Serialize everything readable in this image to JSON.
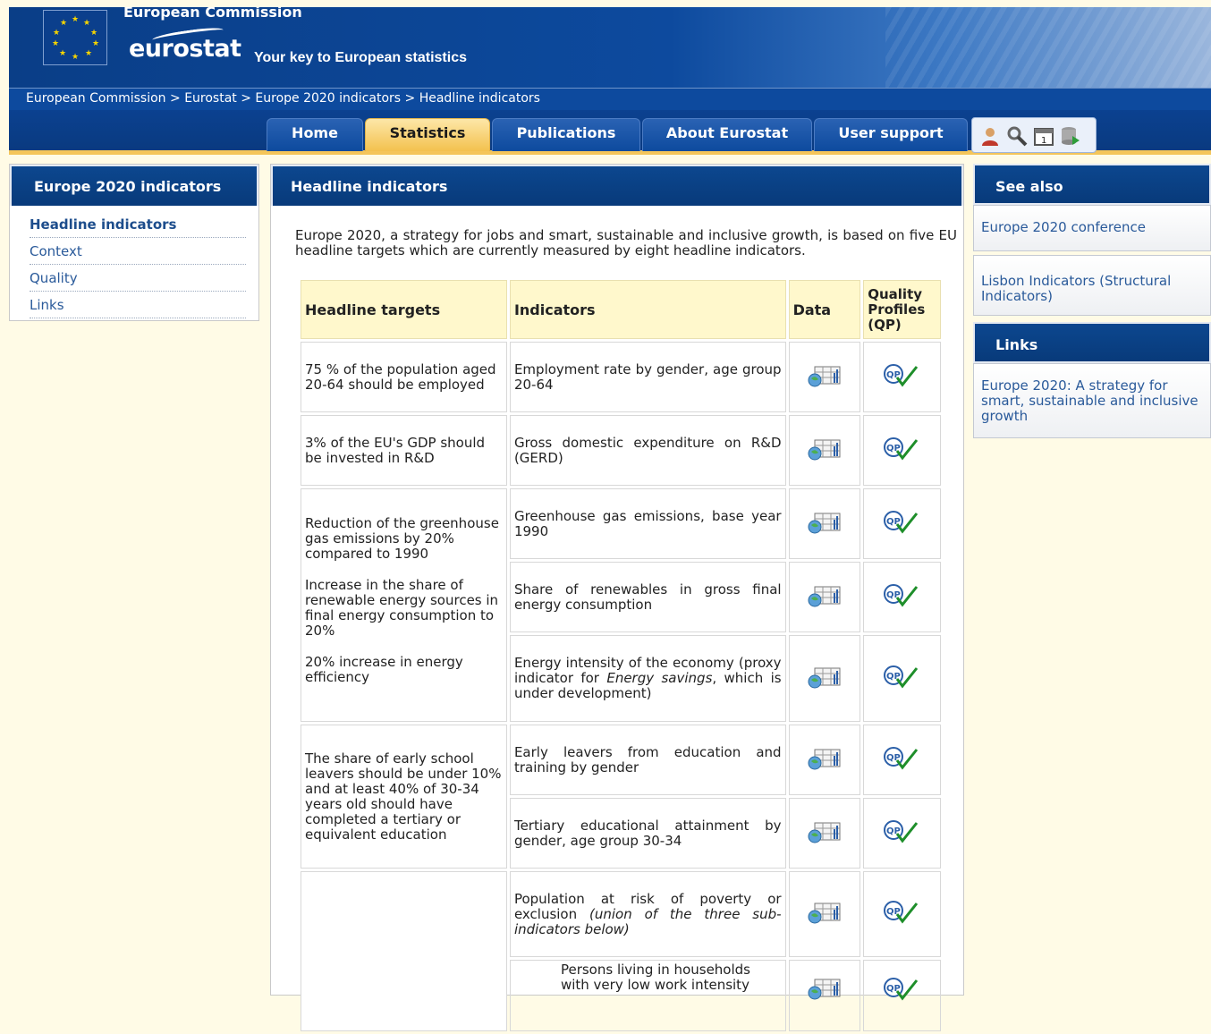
{
  "header": {
    "organization": "European Commission",
    "logo": "eurostat",
    "tagline": "Your key to European statistics"
  },
  "breadcrumb": "European Commission > Eurostat > Europe 2020 indicators > Headline indicators",
  "nav": {
    "tabs": [
      "Home",
      "Statistics",
      "Publications",
      "About Eurostat",
      "User support"
    ],
    "active": "Statistics",
    "tools": [
      "user-icon",
      "search-icon",
      "calendar-icon",
      "database-icon"
    ]
  },
  "left_panel": {
    "title": "Europe 2020 indicators",
    "items": [
      "Headline indicators",
      "Context",
      "Quality",
      "Links"
    ],
    "active": "Headline indicators"
  },
  "main": {
    "title": "Headline indicators",
    "intro": "Europe 2020, a strategy for jobs and smart, sustainable and inclusive growth, is based on five EU headline targets which are currently measured by eight headline indicators.",
    "table": {
      "headers": [
        "Headline targets",
        "Indicators",
        "Data",
        "Quality Profiles (QP)"
      ],
      "targets": [
        "75 % of the population aged 20-64 should be employed",
        "3% of the EU's GDP should be invested in R&D",
        "Reduction of the greenhouse gas emissions by 20% compared to 1990",
        "Increase in the share of renewable energy sources in final energy consumption to 20%",
        "20% increase in energy efficiency",
        "The share of early school leavers should be under 10% and at least 40% of 30-34 years old should have completed a tertiary or equivalent education"
      ],
      "indicators": [
        "Employment rate by gender, age group 20-64",
        "Gross domestic expenditure on R&D (GERD)",
        "Greenhouse gas emissions, base year 1990",
        "Share of renewables in gross final energy consumption",
        "Energy intensity of the economy (proxy indicator for Energy savings, which is under development)",
        "Early leavers from education and training by gender",
        "Tertiary educational attainment by gender, age group 30-34",
        "Population at risk of poverty or exclusion (union of the three sub-indicators below)",
        "Persons living in households with very low work intensity"
      ]
    }
  },
  "right_panel": {
    "see_also_title": "See also",
    "see_also": [
      "Europe 2020 conference",
      "Lisbon Indicators (Structural Indicators)"
    ],
    "links_title": "Links",
    "links": [
      "Europe 2020: A strategy for smart, sustainable and inclusive growth"
    ]
  },
  "colors": {
    "brand_blue": "#0d4a9e",
    "active_tab": "#f3c14e",
    "page_bg": "#fffbe6",
    "table_header": "#fff8cc",
    "link": "#2a5a9a"
  }
}
